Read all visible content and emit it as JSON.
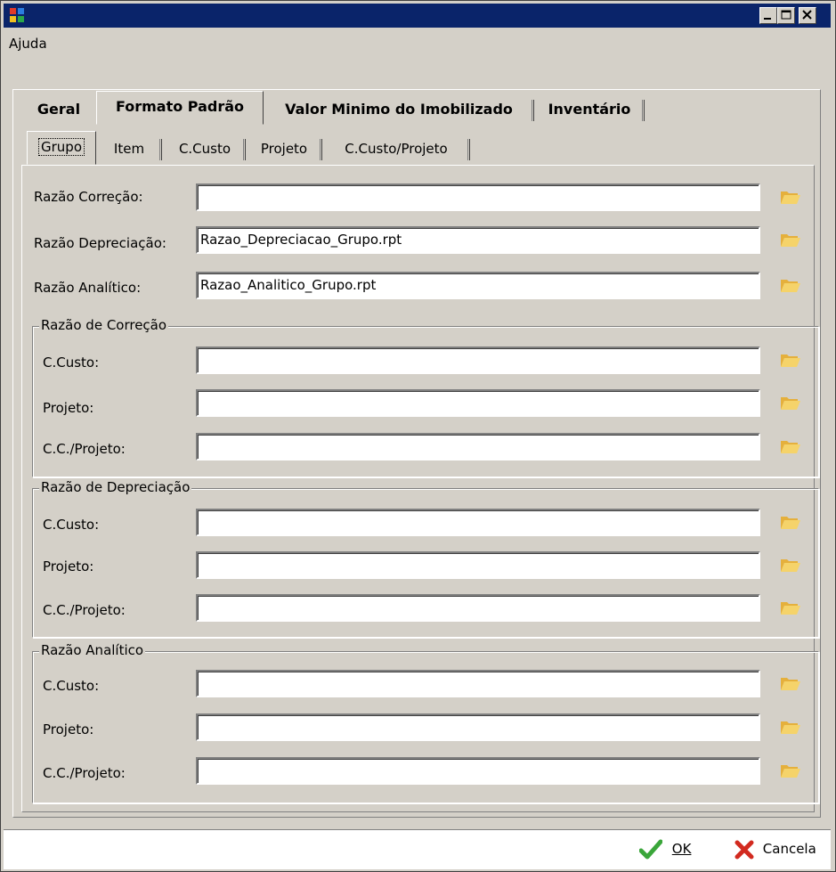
{
  "window": {
    "title": ""
  },
  "menu": {
    "items": [
      "Ajuda"
    ]
  },
  "tabs_main": [
    "Geral",
    "Formato Padrão",
    "Valor Minimo do Imobilizado",
    "Inventário"
  ],
  "tabs_sub": [
    "Grupo",
    "Item",
    "C.Custo",
    "Projeto",
    "C.Custo/Projeto"
  ],
  "main_fields": {
    "correcao": {
      "label": "Razão Correção:",
      "value": ""
    },
    "depreciacao": {
      "label": "Razão Depreciação:",
      "value": "Razao_Depreciacao_Grupo.rpt"
    },
    "analitico": {
      "label": "Razão Analítico:",
      "value": "Razao_Analitico_Grupo.rpt"
    }
  },
  "groups": {
    "correcao": {
      "title": "Razão de Correção",
      "rows": [
        {
          "label": "C.Custo:",
          "value": ""
        },
        {
          "label": "Projeto:",
          "value": ""
        },
        {
          "label": "C.C./Projeto:",
          "value": ""
        }
      ]
    },
    "depreciacao": {
      "title": "Razão de Depreciação",
      "rows": [
        {
          "label": "C.Custo:",
          "value": ""
        },
        {
          "label": "Projeto:",
          "value": ""
        },
        {
          "label": "C.C./Projeto:",
          "value": ""
        }
      ]
    },
    "analitico": {
      "title": "Razão Analítico",
      "rows": [
        {
          "label": "C.Custo:",
          "value": ""
        },
        {
          "label": "Projeto:",
          "value": ""
        },
        {
          "label": "C.C./Projeto:",
          "value": ""
        }
      ]
    }
  },
  "buttons": {
    "ok": "OK",
    "cancel": "Cancela"
  },
  "colors": {
    "titlebar": "#0a246a",
    "face": "#d4d0c8",
    "ok_check": "#3aa63a",
    "cancel_x": "#d22a1f",
    "folder": "#f2c84b"
  }
}
